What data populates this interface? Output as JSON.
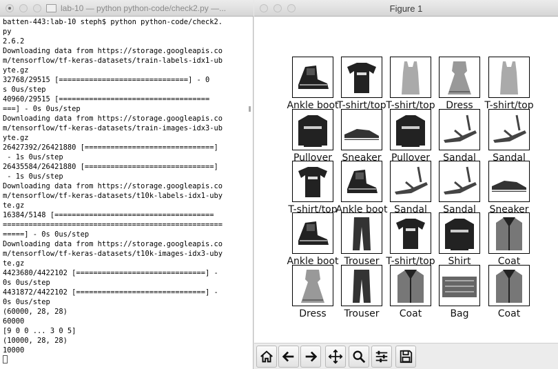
{
  "terminal": {
    "title": "lab-10 — python python-code/check2.py —...",
    "lines": [
      "batten-443:lab-10 steph$ python python-code/check2.",
      "py",
      "2.6.2",
      "Downloading data from https://storage.googleapis.co",
      "m/tensorflow/tf-keras-datasets/train-labels-idx1-ub",
      "yte.gz",
      "32768/29515 [==============================] - 0",
      "s 0us/step",
      "40960/29515 [===================================",
      "===] - 0s 0us/step",
      "Downloading data from https://storage.googleapis.co",
      "m/tensorflow/tf-keras-datasets/train-images-idx3-ub",
      "yte.gz",
      "26427392/26421880 [==============================]",
      " - 1s 0us/step",
      "26435584/26421880 [==============================]",
      " - 1s 0us/step",
      "Downloading data from https://storage.googleapis.co",
      "m/tensorflow/tf-keras-datasets/t10k-labels-idx1-uby",
      "te.gz",
      "16384/5148 [=====================================",
      "===================================================",
      "=====] - 0s 0us/step",
      "Downloading data from https://storage.googleapis.co",
      "m/tensorflow/tf-keras-datasets/t10k-images-idx3-uby",
      "te.gz",
      "4423680/4422102 [==============================] -",
      "0s 0us/step",
      "4431872/4422102 [==============================] -",
      "0s 0us/step",
      "(60000, 28, 28)",
      "60000",
      "[9 0 0 ... 3 0 5]",
      "(10000, 28, 28)",
      "10000"
    ]
  },
  "figure": {
    "title": "Figure 1",
    "images": [
      {
        "label": "Ankle boot",
        "kind": "boot"
      },
      {
        "label": "T-shirt/top",
        "kind": "tshirt"
      },
      {
        "label": "T-shirt/top",
        "kind": "tank"
      },
      {
        "label": "Dress",
        "kind": "dress"
      },
      {
        "label": "T-shirt/top",
        "kind": "tank"
      },
      {
        "label": "Pullover",
        "kind": "pullover"
      },
      {
        "label": "Sneaker",
        "kind": "sneaker"
      },
      {
        "label": "Pullover",
        "kind": "pullover"
      },
      {
        "label": "Sandal",
        "kind": "sandal"
      },
      {
        "label": "Sandal",
        "kind": "sandal"
      },
      {
        "label": "T-shirt/top",
        "kind": "tshirt"
      },
      {
        "label": "Ankle boot",
        "kind": "boot"
      },
      {
        "label": "Sandal",
        "kind": "sandal"
      },
      {
        "label": "Sandal",
        "kind": "sandal"
      },
      {
        "label": "Sneaker",
        "kind": "sneaker"
      },
      {
        "label": "Ankle boot",
        "kind": "boot"
      },
      {
        "label": "Trouser",
        "kind": "trouser"
      },
      {
        "label": "T-shirt/top",
        "kind": "tshirt"
      },
      {
        "label": "Shirt",
        "kind": "pullover"
      },
      {
        "label": "Coat",
        "kind": "coat"
      },
      {
        "label": "Dress",
        "kind": "dress"
      },
      {
        "label": "Trouser",
        "kind": "trouser"
      },
      {
        "label": "Coat",
        "kind": "coat"
      },
      {
        "label": "Bag",
        "kind": "bag"
      },
      {
        "label": "Coat",
        "kind": "coat"
      }
    ]
  },
  "toolbar": {
    "buttons": [
      {
        "name": "home-button",
        "icon": "home-icon"
      },
      {
        "name": "back-button",
        "icon": "arrow-left-icon"
      },
      {
        "name": "forward-button",
        "icon": "arrow-right-icon"
      },
      {
        "name": "pan-button",
        "icon": "move-icon"
      },
      {
        "name": "zoom-button",
        "icon": "magnifier-icon"
      },
      {
        "name": "configure-subplots-button",
        "icon": "sliders-icon"
      },
      {
        "name": "save-button",
        "icon": "floppy-disk-icon"
      }
    ]
  }
}
